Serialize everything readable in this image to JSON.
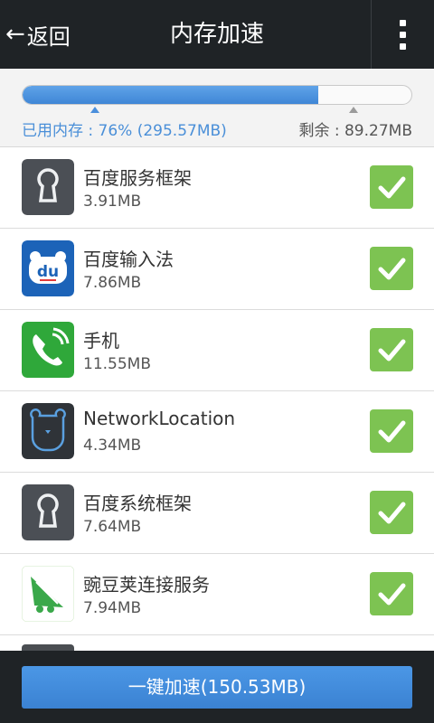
{
  "header": {
    "back_label": "返回",
    "title": "内存加速"
  },
  "memory": {
    "used_text": "已用内存 : 76% (295.57MB)",
    "free_text": "剩余 : 89.27MB",
    "used_fraction": 0.76,
    "colors": {
      "used": "#4b8fdc",
      "free": "#555555"
    }
  },
  "apps": [
    {
      "name": "百度服务框架",
      "size": "3.91MB",
      "icon": "keyhole-icon",
      "checked": true
    },
    {
      "name": "百度输入法",
      "size": "7.86MB",
      "icon": "du-bear-icon",
      "checked": true
    },
    {
      "name": "手机",
      "size": "11.55MB",
      "icon": "phone-icon",
      "checked": true
    },
    {
      "name": "NetworkLocation",
      "size": "4.34MB",
      "icon": "bear-face-icon",
      "checked": true
    },
    {
      "name": "百度系统框架",
      "size": "7.64MB",
      "icon": "keyhole-icon",
      "checked": true
    },
    {
      "name": "豌豆荚连接服务",
      "size": "7.94MB",
      "icon": "wandoujia-icon",
      "checked": true
    }
  ],
  "footer": {
    "boost_label": "一键加速(150.53MB)"
  },
  "theme": {
    "accent": "#4a8fd8",
    "check": "#7dc352",
    "bar": "#1f2326"
  }
}
